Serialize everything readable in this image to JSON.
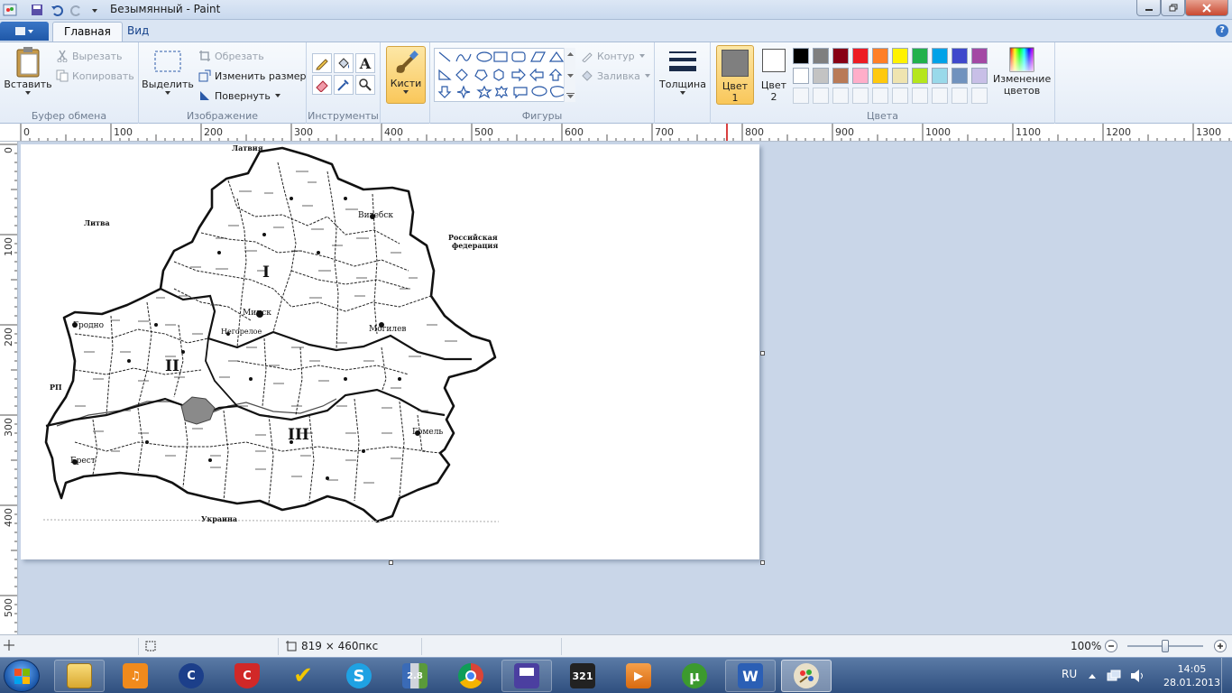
{
  "window": {
    "title": "Безымянный - Paint"
  },
  "tabs": [
    {
      "label": "Главная",
      "active": true
    },
    {
      "label": "Вид",
      "active": false
    }
  ],
  "ribbon": {
    "clipboard": {
      "label": "Буфер обмена",
      "paste": "Вставить",
      "cut": "Вырезать",
      "copy": "Копировать"
    },
    "image": {
      "label": "Изображение",
      "select": "Выделить",
      "crop": "Обрезать",
      "resize": "Изменить размер",
      "rotate": "Повернуть"
    },
    "tools": {
      "label": "Инструменты"
    },
    "brushes": {
      "label": "Кисти"
    },
    "shapes": {
      "label": "Фигуры",
      "outline": "Контур",
      "fill": "Заливка"
    },
    "size": {
      "label": "Толщина"
    },
    "color1": {
      "label": "Цвет 1",
      "value": "#7f7f7f"
    },
    "color2": {
      "label": "Цвет 2",
      "value": "#ffffff"
    },
    "colors": {
      "label": "Цвета",
      "edit_label": "Изменение цветов",
      "row1": [
        "#000000",
        "#7f7f7f",
        "#880015",
        "#ed1c24",
        "#ff7f27",
        "#fff200",
        "#22b14c",
        "#00a2e8",
        "#3f48cc",
        "#a349a4"
      ],
      "row2": [
        "#ffffff",
        "#c3c3c3",
        "#b97a57",
        "#ffaec9",
        "#ffc90e",
        "#efe4b0",
        "#b5e61d",
        "#99d9ea",
        "#7092be",
        "#c8bfe7"
      ]
    }
  },
  "ruler": {
    "top": [
      "0",
      "100",
      "200",
      "300",
      "400",
      "500",
      "600",
      "700",
      "800",
      "900",
      "1000",
      "1100",
      "1200",
      "1300"
    ],
    "left": [
      "0",
      "100",
      "200",
      "300",
      "400",
      "500"
    ]
  },
  "map": {
    "labels": {
      "latvia": "Латвия",
      "lithuania": "Литва",
      "russia1": "Российская",
      "russia2": "федерация",
      "poland": "РП",
      "ukraine": "Украина",
      "vitebsk": "Витебск",
      "grodno": "Гродно",
      "minsk": "Минск",
      "mogilev": "Могилев",
      "gomel": "Гомель",
      "brest": "Брест",
      "negoreloe": "Негорелое",
      "zone1": "I",
      "zone2": "II",
      "zone3": "III"
    }
  },
  "status": {
    "canvas_size": "819 × 460пкс",
    "zoom": "100%"
  },
  "taskbar": {
    "lang": "RU",
    "time": "14:05",
    "date": "28.01.2013"
  }
}
